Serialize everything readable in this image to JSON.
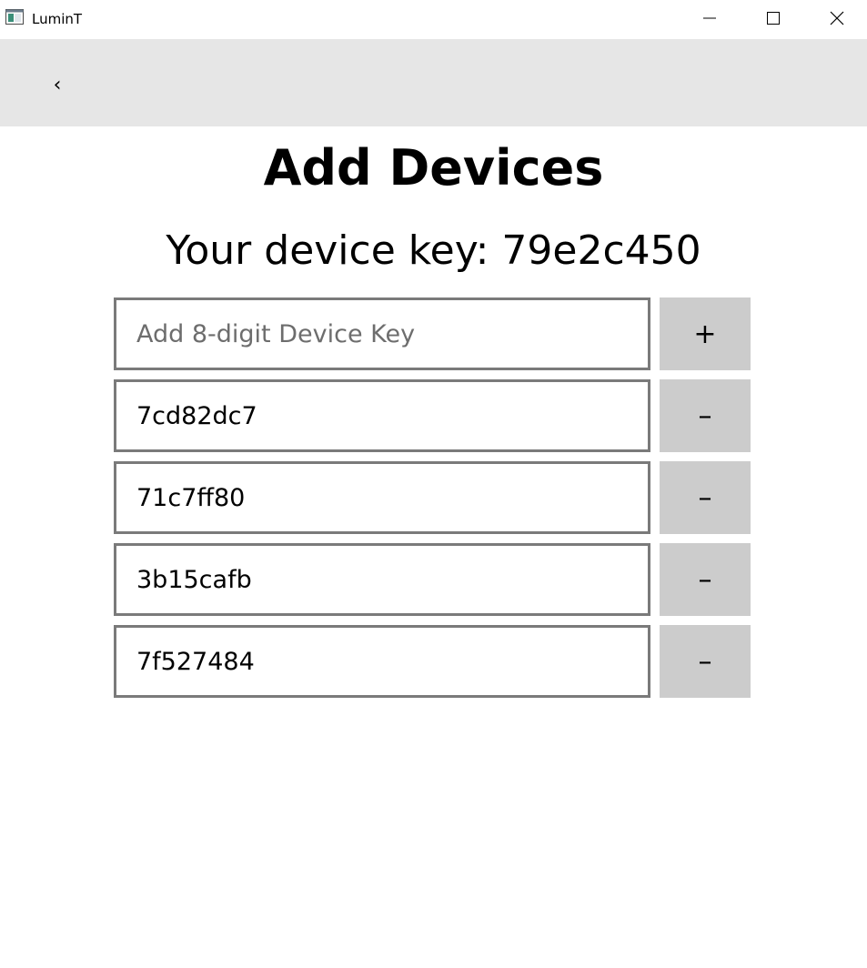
{
  "window": {
    "title": "LuminT",
    "icon": "app-window-icon",
    "controls": {
      "minimize_icon": "minimize-icon",
      "maximize_icon": "maximize-icon",
      "close_icon": "close-icon"
    }
  },
  "navbar": {
    "back_label": "‹",
    "background": "#e6e6e6"
  },
  "main": {
    "title": "Add Devices",
    "device_key_label": "Your device key: ",
    "device_key_value": "79e2c450",
    "add_field": {
      "placeholder": "Add 8-digit Device Key",
      "value": "",
      "button_label": "+"
    },
    "devices": [
      {
        "key": "7cd82dc7",
        "button_label": "–"
      },
      {
        "key": "71c7ff80",
        "button_label": "–"
      },
      {
        "key": "3b15cafb",
        "button_label": "–"
      },
      {
        "key": "7f527484",
        "button_label": "–"
      }
    ]
  },
  "colors": {
    "field_border": "#7a7a7a",
    "button_bg": "#cccccc",
    "placeholder": "#6d6d6d"
  }
}
